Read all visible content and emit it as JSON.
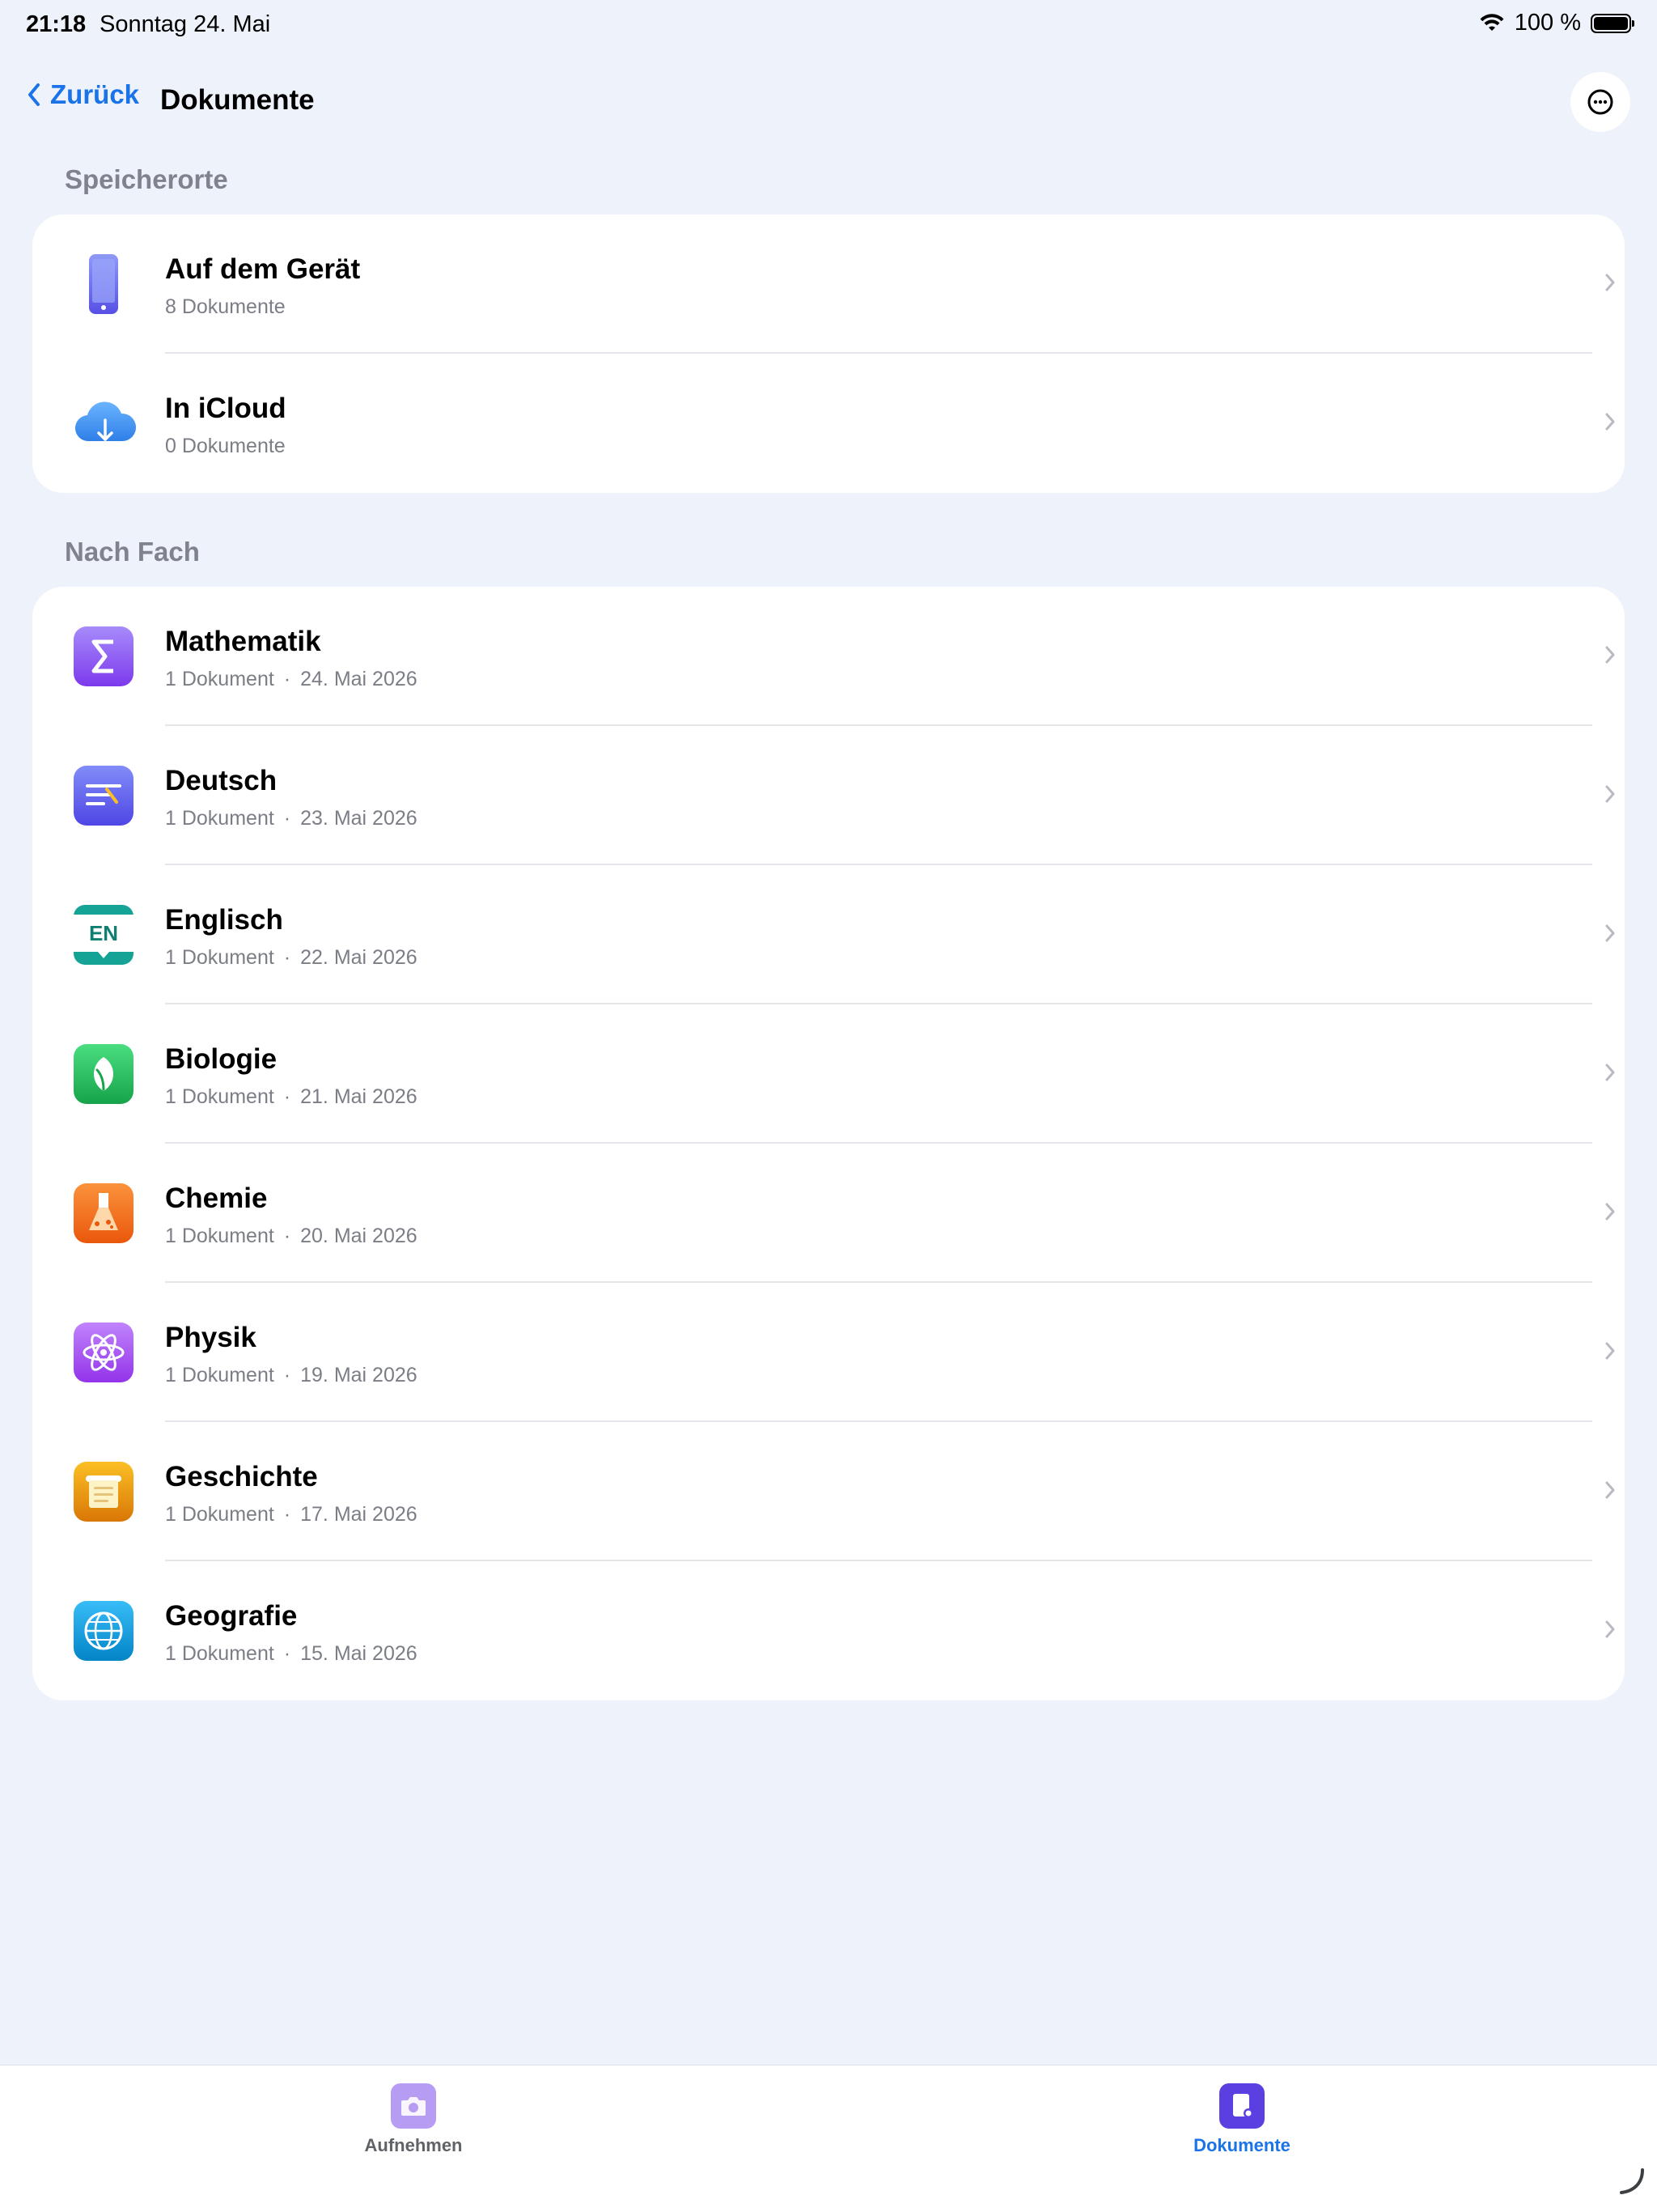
{
  "status_bar": {
    "time": "21:18",
    "date": "Sonntag 24. Mai",
    "battery_text": "100 %",
    "battery_level": 1.0
  },
  "nav": {
    "back_label": "Zurück",
    "title": "Dokumente",
    "more_icon": "ellipsis-circle-icon"
  },
  "storage": {
    "header": "Speicherorte",
    "items": [
      {
        "title": "Auf dem Gerät",
        "subtitle": "8 Dokumente",
        "icon": "iphone-icon"
      },
      {
        "title": "In iCloud",
        "subtitle": "0 Dokumente",
        "icon": "icloud-download-icon"
      }
    ]
  },
  "subjects": {
    "header": "Nach Fach",
    "items": [
      {
        "title": "Mathematik",
        "count": "1 Dokument",
        "date": "24. Mai 2026",
        "icon": "sigma-icon",
        "color": "#8b5cf6"
      },
      {
        "title": "Deutsch",
        "count": "1 Dokument",
        "date": "23. Mai 2026",
        "icon": "text-lines-icon",
        "color": "#6366f1"
      },
      {
        "title": "Englisch",
        "count": "1 Dokument",
        "date": "22. Mai 2026",
        "icon": "en-speech-bubble-icon",
        "color": "#14a394",
        "icon_text": "EN"
      },
      {
        "title": "Biologie",
        "count": "1 Dokument",
        "date": "21. Mai 2026",
        "icon": "leaf-icon",
        "color": "#22c55e"
      },
      {
        "title": "Chemie",
        "count": "1 Dokument",
        "date": "20. Mai 2026",
        "icon": "flask-icon",
        "color": "#f97316"
      },
      {
        "title": "Physik",
        "count": "1 Dokument",
        "date": "19. Mai 2026",
        "icon": "atom-icon",
        "color": "#a855f7"
      },
      {
        "title": "Geschichte",
        "count": "1 Dokument",
        "date": "17. Mai 2026",
        "icon": "scroll-icon",
        "color": "#f59e0b"
      },
      {
        "title": "Geografie",
        "count": "1 Dokument",
        "date": "15. Mai 2026",
        "icon": "globe-icon",
        "color": "#0ea5e9"
      }
    ]
  },
  "tab_bar": {
    "tabs": [
      {
        "label": "Aufnehmen",
        "icon": "camera-icon",
        "active": false
      },
      {
        "label": "Dokumente",
        "icon": "documents-icon",
        "active": true
      }
    ],
    "active_color": "#1a73e8",
    "inactive_color": "#5f6368"
  }
}
